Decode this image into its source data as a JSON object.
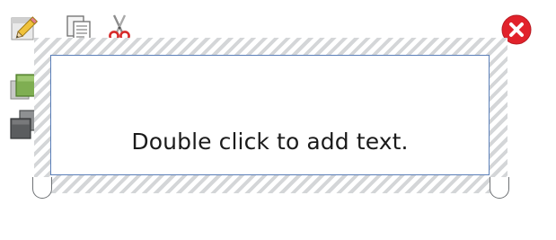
{
  "toolbar": {
    "edit_icon": "pencil-icon",
    "copy_icon": "copy-pages-icon",
    "cut_icon": "scissors-icon",
    "close_icon": "close-circle-icon"
  },
  "side_tools": {
    "bring_forward_icon": "bring-forward-layer-icon",
    "send_backward_icon": "send-backward-layer-icon"
  },
  "textbox": {
    "placeholder": "Double click to add text."
  },
  "colors": {
    "close_red": "#e1222b",
    "box_border": "#5b7fb8",
    "hatch": "#d4d6d8",
    "layer_green": "#7fae52",
    "layer_dark": "#5b5d5f"
  }
}
